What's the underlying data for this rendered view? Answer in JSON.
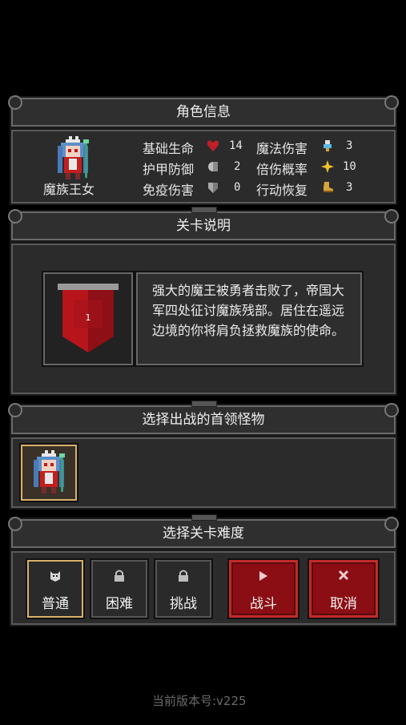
{
  "character_info": {
    "title": "角色信息",
    "name": "魔族王女",
    "stats_left": [
      {
        "label": "基础生命",
        "icon": "heart-icon",
        "value": "14"
      },
      {
        "label": "护甲防御",
        "icon": "shield-round-icon",
        "value": "2"
      },
      {
        "label": "免疫伤害",
        "icon": "shield-icon",
        "value": "0"
      }
    ],
    "stats_right": [
      {
        "label": "魔法伤害",
        "icon": "potion-icon",
        "value": "3"
      },
      {
        "label": "倍伤概率",
        "icon": "star-burst-icon",
        "value": "10"
      },
      {
        "label": "行动恢复",
        "icon": "boot-icon",
        "value": "3"
      }
    ]
  },
  "level_info": {
    "title": "关卡说明",
    "banner_number": "1",
    "description": "强大的魔王被勇者击败了，帝国大军四处征讨魔族残部。居住在遥远边境的你将肩负拯救魔族的使命。"
  },
  "boss_select": {
    "title": "选择出战的首领怪物"
  },
  "difficulty": {
    "title": "选择关卡难度",
    "buttons": [
      {
        "label": "普通",
        "icon": "cat-face-icon"
      },
      {
        "label": "困难",
        "icon": "lock-icon"
      },
      {
        "label": "挑战",
        "icon": "lock-icon"
      }
    ],
    "fight_label": "战斗",
    "cancel_label": "取消"
  },
  "footer": {
    "version": "当前版本号:v225"
  },
  "colors": {
    "accent_red": "#8b0e14",
    "selected_border": "#d8b06a"
  }
}
